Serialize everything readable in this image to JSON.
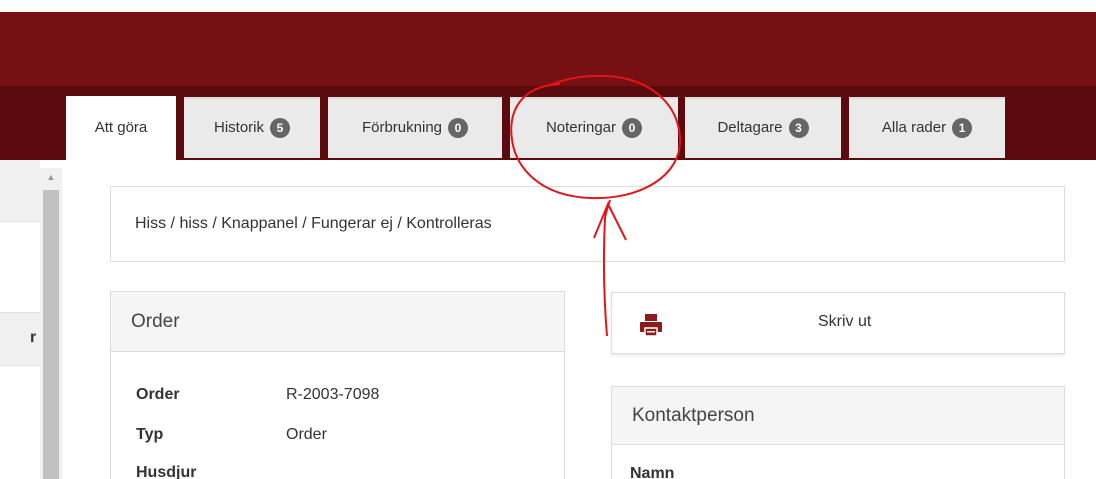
{
  "tabs": [
    {
      "label": "Att göra",
      "badge": null,
      "active": true
    },
    {
      "label": "Historik",
      "badge": "5"
    },
    {
      "label": "Förbrukning",
      "badge": "0"
    },
    {
      "label": "Noteringar",
      "badge": "0"
    },
    {
      "label": "Deltagare",
      "badge": "3"
    },
    {
      "label": "Alla rader",
      "badge": "1"
    }
  ],
  "left_panel": {
    "partial_text": "r"
  },
  "breadcrumb": "Hiss / hiss / Knappanel / Fungerar ej / Kontrolleras",
  "order_panel": {
    "title": "Order",
    "rows": [
      {
        "label": "Order",
        "value": "R-2003-7098"
      },
      {
        "label": "Typ",
        "value": "Order"
      },
      {
        "label": "Husdjur",
        "value": ""
      }
    ]
  },
  "print_button": {
    "label": "Skriv ut",
    "icon": "printer-icon"
  },
  "contact_panel": {
    "title": "Kontaktperson",
    "name_label": "Namn"
  },
  "colors": {
    "header": "#761013",
    "tabstrip": "#5b0b0e",
    "badge": "#666666",
    "annotation": "#e0161b",
    "print_icon": "#8a1a1d"
  }
}
